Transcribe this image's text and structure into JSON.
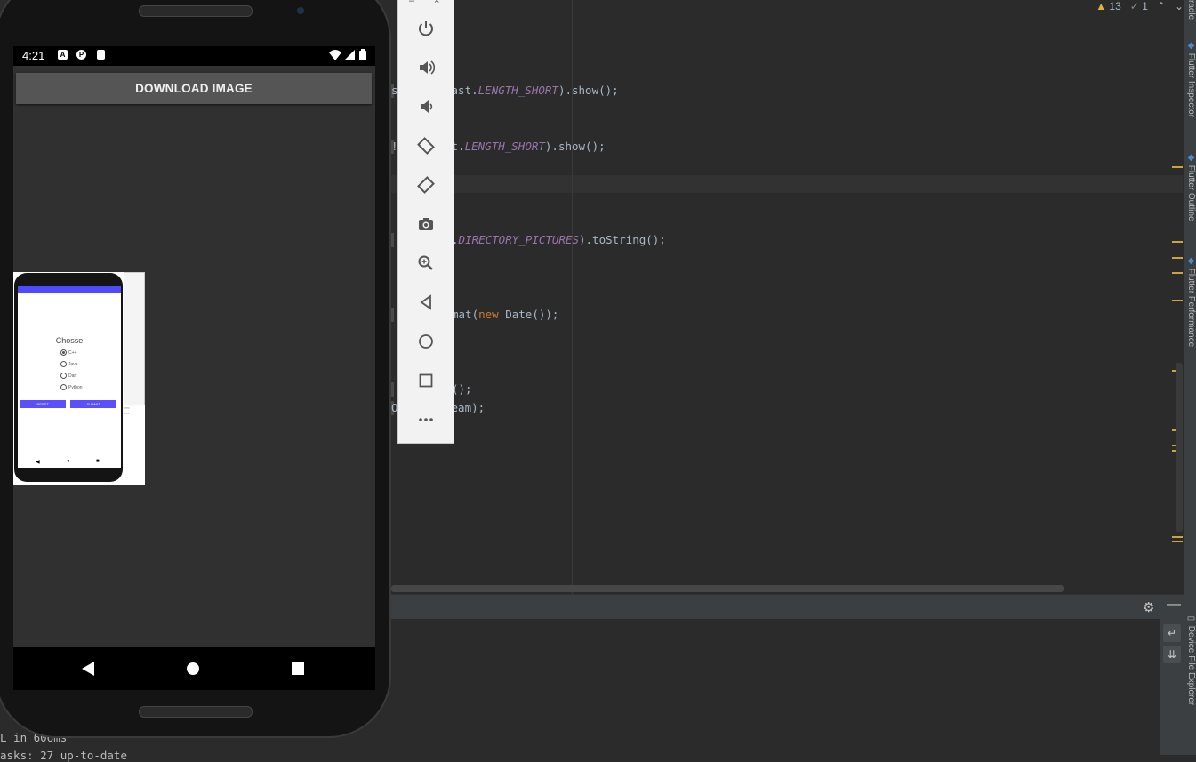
{
  "editor": {
    "inspections": {
      "warnings": "13",
      "weak_warnings": "1"
    },
    "code_lines": [
      {
        "prefix": "s",
        "parts": [
          {
            "t": "ast."
          },
          {
            "t": "LENGTH_SHORT",
            "it": true
          },
          {
            "t": ").show();"
          }
        ]
      },
      {
        "prefix": "!",
        "parts": [
          {
            "t": "t."
          },
          {
            "t": "LENGTH_SHORT",
            "it": true
          },
          {
            "t": ").show();"
          }
        ]
      },
      {
        "prefix": "",
        "parts": [
          {
            "t": "."
          },
          {
            "t": "DIRECTORY_PICTURES",
            "it": true
          },
          {
            "t": ").toString();"
          }
        ]
      },
      {
        "prefix": "",
        "parts": [
          {
            "t": "mat("
          },
          {
            "t": "new",
            "kw": true
          },
          {
            "t": " Date());"
          }
        ]
      },
      {
        "prefix": "",
        "parts": [
          {
            "t": "();"
          }
        ]
      },
      {
        "prefix": "O",
        "parts": [
          {
            "t": "eam);"
          }
        ]
      }
    ]
  },
  "right_tabs": [
    {
      "label": "radle"
    },
    {
      "label": "Flutter Inspector"
    },
    {
      "label": "Flutter Outline"
    },
    {
      "label": "Flutter Performance"
    },
    {
      "label": "Device File Explorer"
    }
  ],
  "console": {
    "lines": [
      "L in 606ms",
      "asks: 27 up-to-date"
    ]
  },
  "emulator_toolbar": {
    "buttons": [
      {
        "name": "power-icon",
        "glyph": "⏻"
      },
      {
        "name": "volume-up-icon",
        "glyph": "🔊"
      },
      {
        "name": "volume-down-icon",
        "glyph": "🔉"
      },
      {
        "name": "rotate-left-icon",
        "glyph": "⟲"
      },
      {
        "name": "rotate-right-icon",
        "glyph": "⟳"
      },
      {
        "name": "camera-icon",
        "glyph": "📷"
      },
      {
        "name": "zoom-icon",
        "glyph": "🔍"
      },
      {
        "name": "back-icon",
        "glyph": "◁"
      },
      {
        "name": "home-icon",
        "glyph": "○"
      },
      {
        "name": "overview-icon",
        "glyph": "□"
      },
      {
        "name": "more-icon",
        "glyph": "•••"
      }
    ],
    "window_controls": {
      "minimize": "–",
      "close": "×"
    }
  },
  "phone": {
    "status": {
      "time": "4:21"
    },
    "download_button": "DOWNLOAD IMAGE",
    "nav": {
      "back": "◀",
      "home": "●",
      "recents": "■"
    },
    "mini_screenshot": {
      "title": "Chosse",
      "options": [
        "C++",
        "Java",
        "Dart",
        "Python"
      ],
      "buttons": {
        "reset": "RESET",
        "submit": "SUBMIT"
      }
    }
  }
}
